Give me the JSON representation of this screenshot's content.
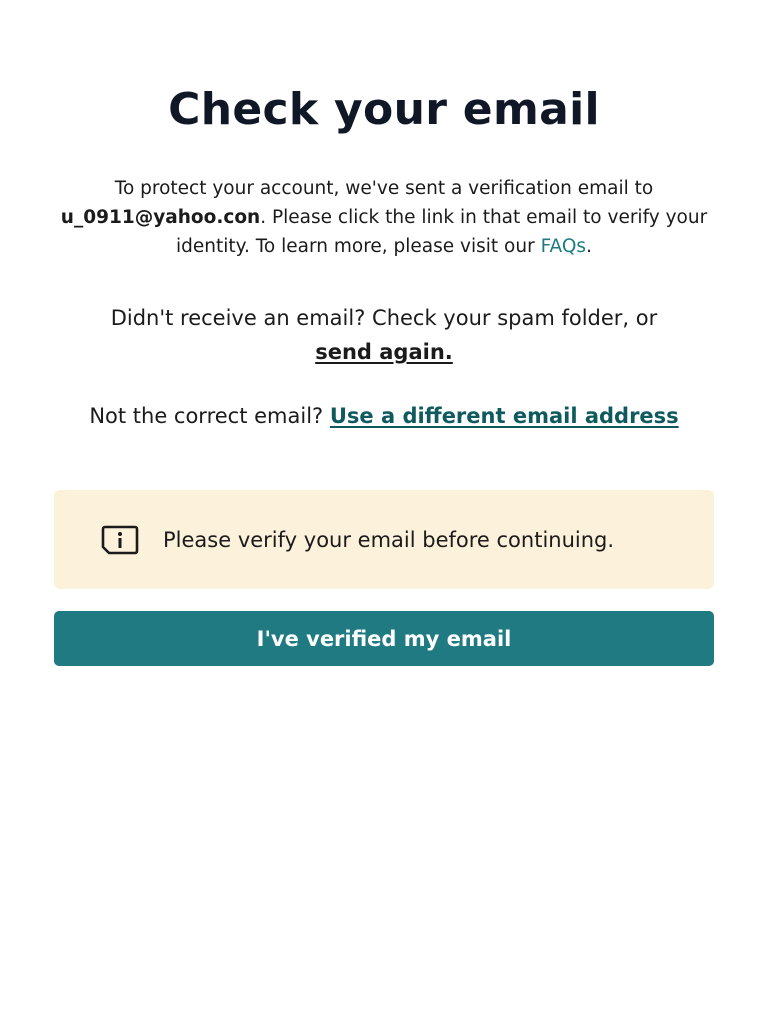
{
  "title": "Check your email",
  "intro": {
    "before_email": "To protect your account, we've sent a verification email to ",
    "email": "u_0911@yahoo.con",
    "after_email": ". Please click the link in that email to verify your identity. To learn more, please visit our ",
    "faq_link": "FAQs",
    "end": "."
  },
  "resend": {
    "prompt": "Didn't receive an email? Check your spam folder, or",
    "link": "send again."
  },
  "wrong_email": {
    "prompt": "Not the correct email? ",
    "link": "Use a different email address"
  },
  "notice": {
    "icon": "info-icon",
    "text": "Please verify your email before continuing."
  },
  "verify_button": {
    "label": "I've verified my email"
  },
  "colors": {
    "accent": "#1f7a82",
    "link": "#1e7b82",
    "notice_bg": "#fcf1da"
  }
}
